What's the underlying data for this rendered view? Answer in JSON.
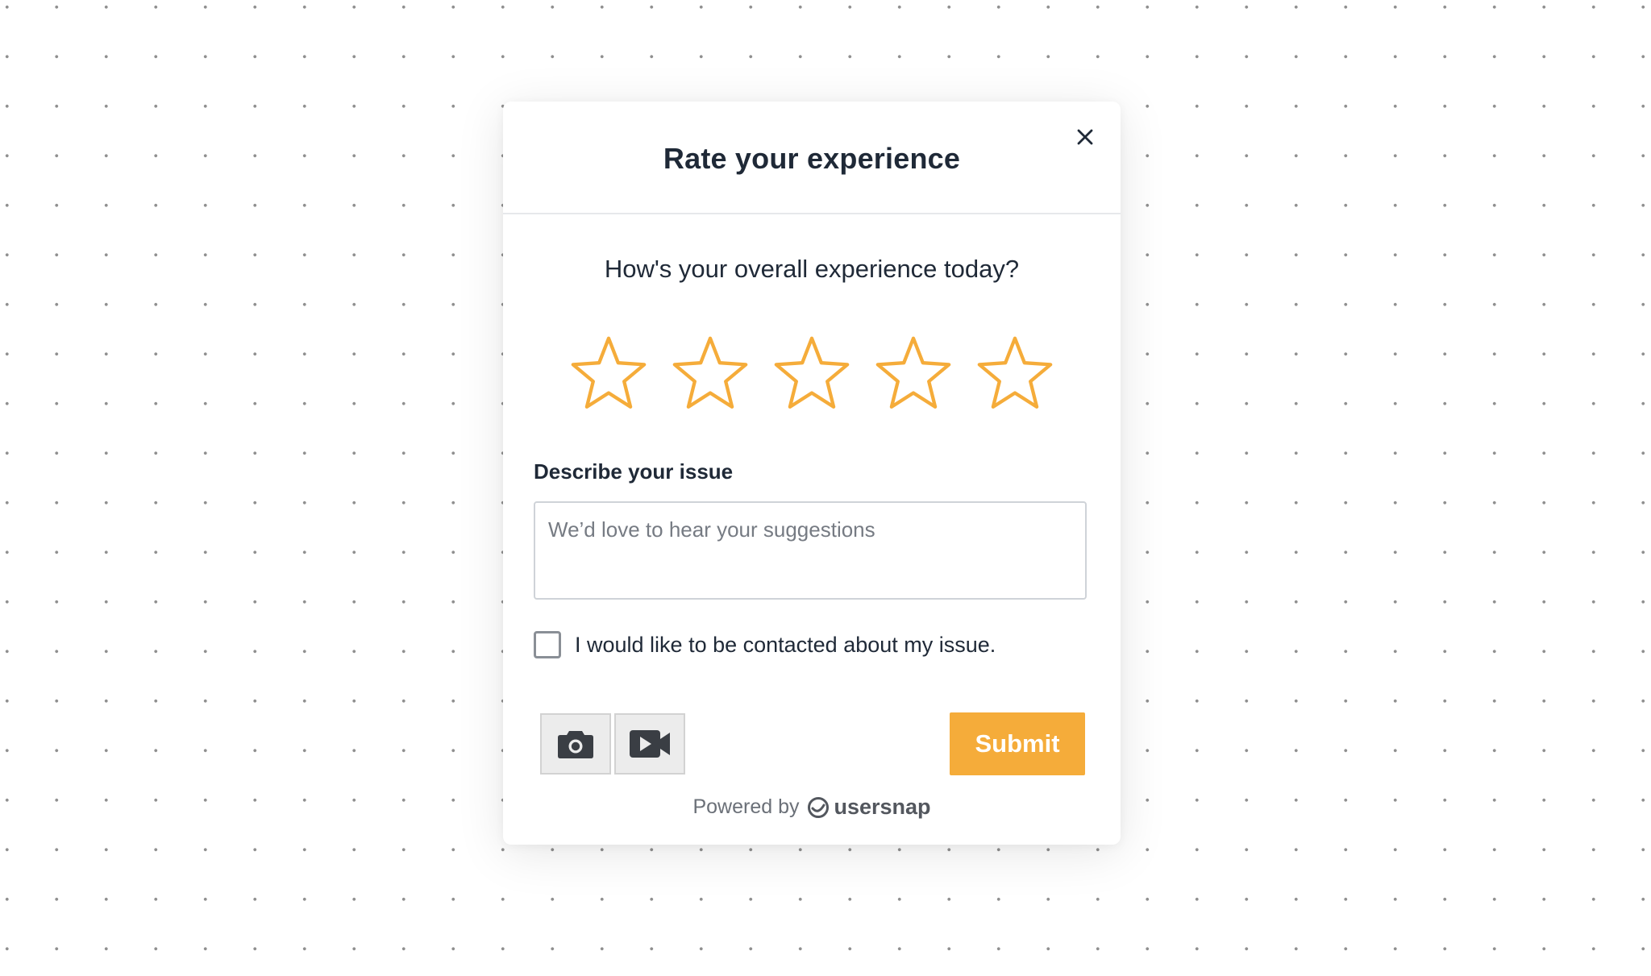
{
  "widget": {
    "title": "Rate your experience",
    "close_icon": "close-icon",
    "question": "How's your overall experience today?",
    "rating": {
      "max": 5,
      "selected": 0,
      "icon": "star-outline-icon",
      "color": "#f5ac3a",
      "stars": [
        {
          "value": 1
        },
        {
          "value": 2
        },
        {
          "value": 3
        },
        {
          "value": 4
        },
        {
          "value": 5
        }
      ]
    },
    "issue_field": {
      "label": "Describe your issue",
      "placeholder": "We’d love to hear your suggestions",
      "value": ""
    },
    "contact_checkbox": {
      "label": "I would like to be contacted about my issue.",
      "checked": false
    },
    "tools": {
      "screenshot_icon": "camera-icon",
      "record_icon": "video-camera-icon"
    },
    "submit": {
      "label": "Submit",
      "color": "#f5ac3a"
    },
    "footer": {
      "powered_by": "Powered by",
      "brand_icon": "usersnap-logo-icon",
      "brand": "usersnap"
    }
  }
}
